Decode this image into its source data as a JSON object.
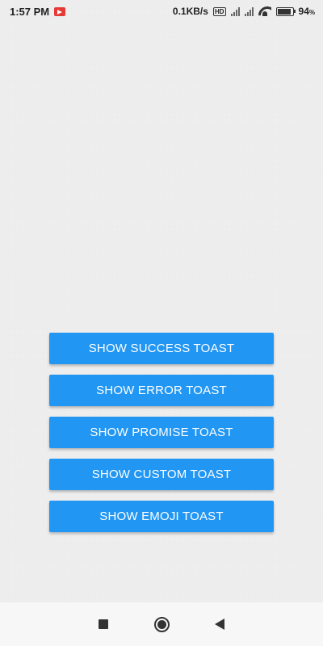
{
  "status_bar": {
    "time": "1:57 PM",
    "notification_icon": "video-recorder-icon",
    "net_speed": "0.1KB/s",
    "hd_badge": "HD",
    "battery_level": "94",
    "battery_unit": "%",
    "battery_fraction": 0.94
  },
  "buttons": {
    "success": "SHOW SUCCESS TOAST",
    "error": "SHOW ERROR TOAST",
    "promise": "SHOW PROMISE TOAST",
    "custom": "SHOW CUSTOM TOAST",
    "emoji": "SHOW EMOJI TOAST"
  },
  "nav_bar": {
    "recents_icon": "square-icon",
    "home_icon": "circle-icon",
    "back_icon": "triangle-back-icon"
  },
  "colors": {
    "button_bg": "#2196f3",
    "button_text": "#ffffff",
    "background": "#efefef"
  }
}
